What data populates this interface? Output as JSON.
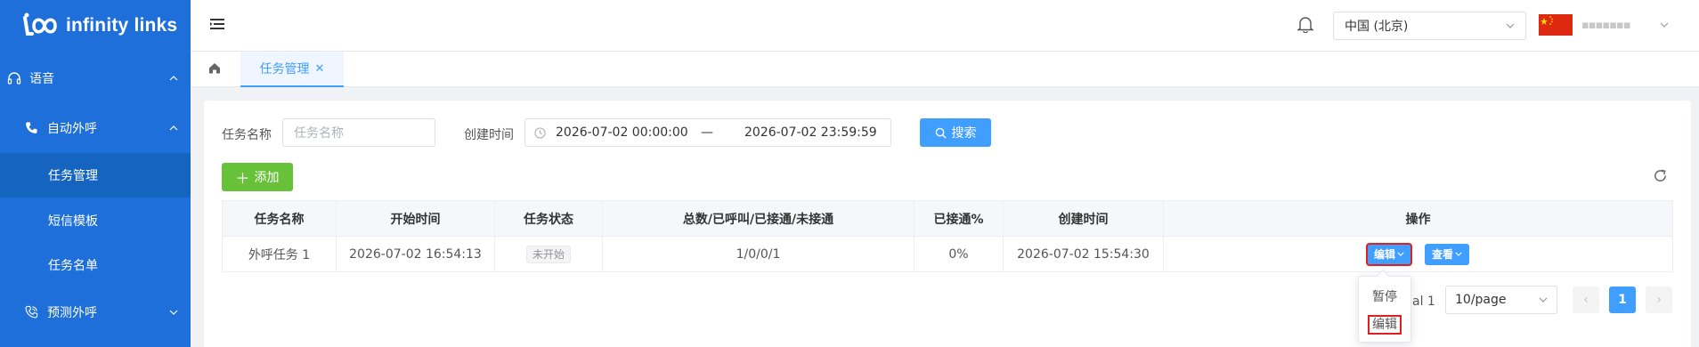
{
  "app": {
    "logo_text": "infinity links"
  },
  "sidebar": {
    "items": [
      {
        "label": "语音",
        "icon": "headset-icon",
        "arrow": "chevron-up-icon"
      },
      {
        "label": "自动外呼",
        "icon": "phone-icon",
        "arrow": "chevron-up-icon"
      },
      {
        "label": "任务管理",
        "active": true
      },
      {
        "label": "短信模板"
      },
      {
        "label": "任务名单"
      },
      {
        "label": "预测外呼",
        "icon": "phone-call-icon",
        "arrow": "chevron-down-icon"
      }
    ]
  },
  "header": {
    "region": "中国 (北京)",
    "user_name": "▪▪▪▪▪▪▪"
  },
  "tabs": {
    "active_label": "任务管理"
  },
  "filters": {
    "task_name_label": "任务名称",
    "task_name_placeholder": "任务名称",
    "created_label": "创建时间",
    "date_start": "2026-07-02 00:00:00",
    "date_sep": "—",
    "date_end": "2026-07-02 23:59:59",
    "search_label": "搜索",
    "add_label": "添加"
  },
  "table": {
    "columns": [
      "任务名称",
      "开始时间",
      "任务状态",
      "总数/已呼叫/已接通/未接通",
      "已接通%",
      "创建时间",
      "操作"
    ],
    "rows": [
      {
        "name": "外呼任务 1",
        "start": "2026-07-02 16:54:13",
        "status": "未开始",
        "counts": "1/0/0/1",
        "connected_pct": "0%",
        "created": "2026-07-02 15:54:30",
        "edit_label": "编辑",
        "view_label": "查看"
      }
    ]
  },
  "pagination": {
    "total_text": "al 1",
    "page_size": "10/page",
    "current_page": "1"
  },
  "dropdown": {
    "items": [
      "暂停",
      "编辑"
    ]
  },
  "colors": {
    "sidebar": "#1e6fd9",
    "primary": "#409eff",
    "success": "#67c23a",
    "highlight": "#e02020"
  }
}
